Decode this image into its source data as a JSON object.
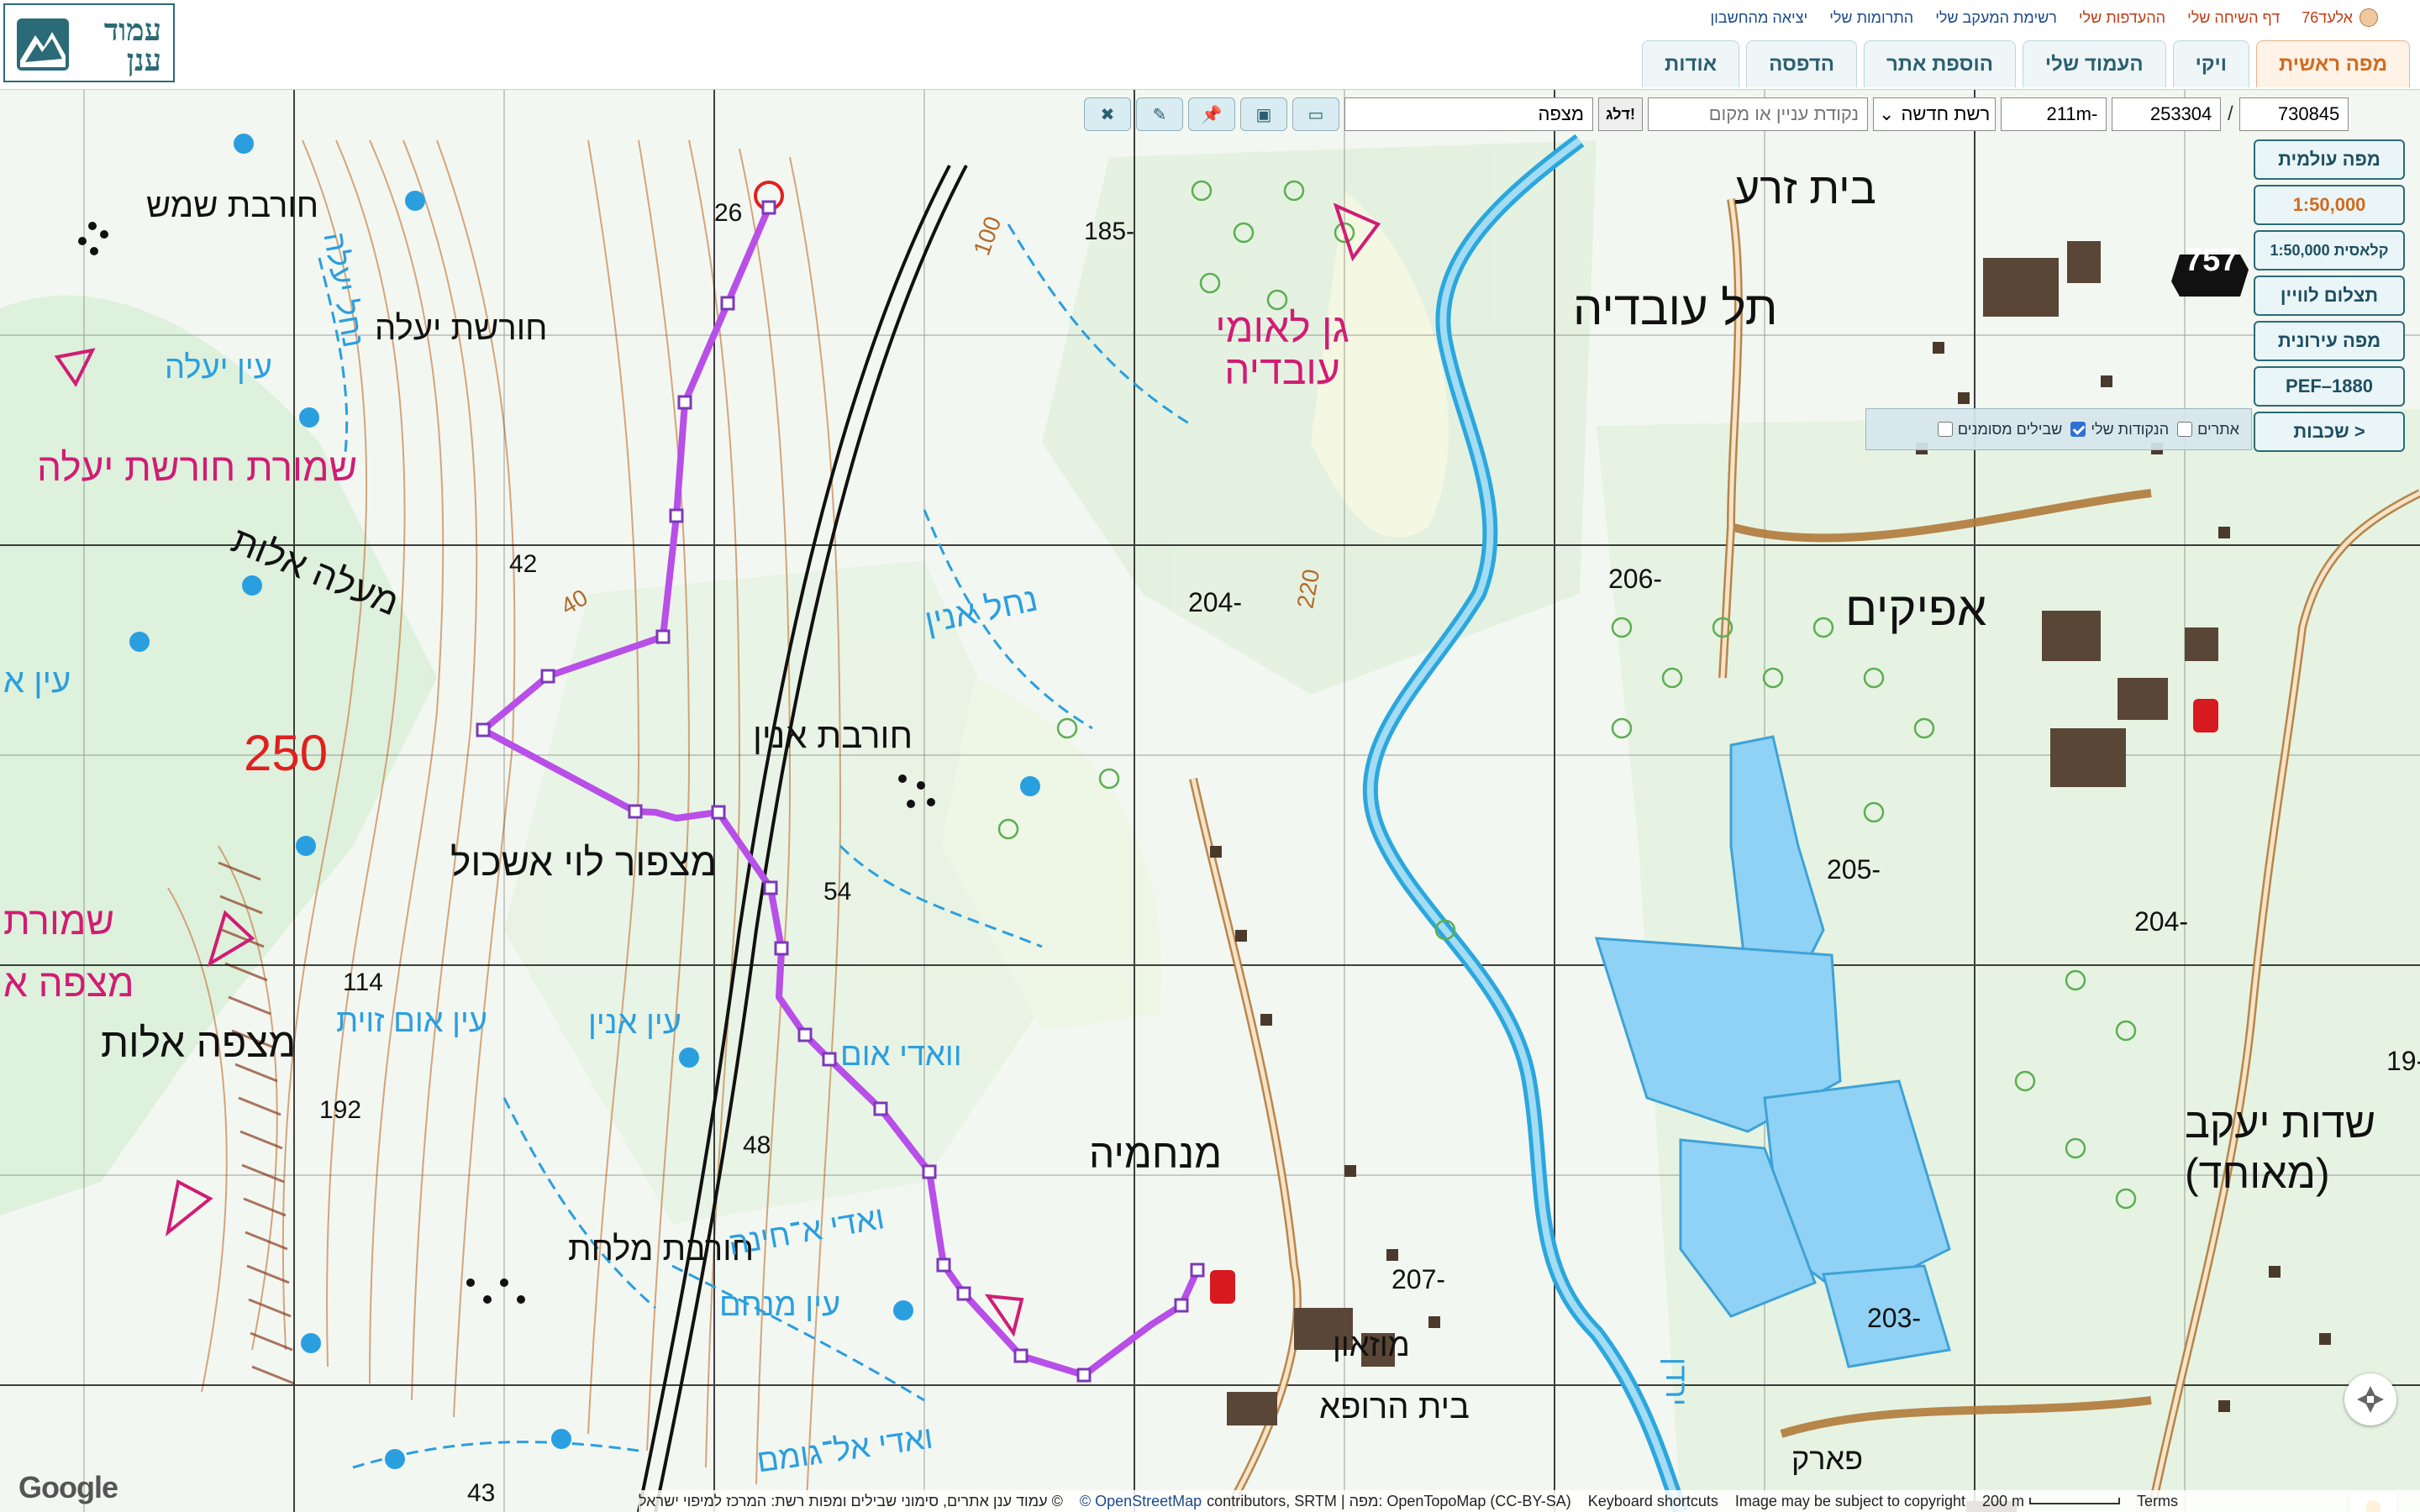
{
  "logo": {
    "line1": "עמוד",
    "line2": "ענן"
  },
  "user_links": {
    "user": "אלעד76",
    "items": [
      "דף השיחה שלי",
      "ההעדפות שלי",
      "רשימת המעקב שלי",
      "התרומות שלי",
      "יציאה מהחשבון"
    ]
  },
  "tabs": [
    "מפה ראשית",
    "ויקי",
    "העמוד שלי",
    "הוספת אתר",
    "הדפסה",
    "אודות"
  ],
  "toolbar": {
    "coord_x": "730845",
    "coord_sep": "/",
    "coord_y": "253304",
    "elevation": "211m-",
    "grid_select": "רשת חדשה",
    "search_placeholder": "נקודת עניין או מקום",
    "jump_button": "דלג!",
    "place_value": "מצפה",
    "icons": [
      "folder-open-icon",
      "save-icon",
      "pin-icon",
      "pencil-icon",
      "close-icon"
    ]
  },
  "layers": {
    "buttons": [
      "מפה עולמית",
      "1:50,000",
      "1:50,000 קלאסית",
      "תצלום לוויין",
      "מפה עירונית",
      "PEF–1880",
      "שכבות >"
    ],
    "active": "1:50,000",
    "overlays": [
      {
        "label": "אתרים",
        "checked": false
      },
      {
        "label": "הנקודות שלי",
        "checked": true
      },
      {
        "label": "שבילים מסומנים",
        "checked": false
      }
    ]
  },
  "map": {
    "places": [
      "חורבת שמש",
      "חורשת יעלה",
      "עין יעלה",
      "שמורת חורשת יעלה",
      "מעלה אלות",
      "עין א",
      "חורבת אנין",
      "מצפור לוי אשכול",
      "מצפה אלות",
      "שמורת",
      "מצפה א",
      "עין אום זוית",
      "עין אנין",
      "וואדי אום",
      "חורבת מלחת",
      "ואדי א־חינה",
      "עין מנחם",
      "ואדי אל־גומם",
      "מנחמיה",
      "מוזאון",
      "בית הרופא",
      "גן לאומי עובדיה",
      "תל עובדיה",
      "בית זרע",
      "אפיקים",
      "נחל אנין",
      "נחל יעלה",
      "ירדן",
      "שדות יעקב (מאוחד)",
      "פארק"
    ],
    "elevations": [
      "26",
      "42",
      "40",
      "54",
      "114",
      "192",
      "48",
      "43",
      "185-",
      "204-",
      "206-",
      "205-",
      "204-",
      "203-",
      "207-",
      "19-",
      "100",
      "220"
    ],
    "spot_250": "250",
    "road_757": "757"
  },
  "attribution": {
    "google": "Google",
    "left": "© עמוד ענן אתרים, סימוני שבילים ומפות רשת: המרכז למיפוי ישראל",
    "osm": "© OpenStreetMap",
    "osm_rest": "contributors, SRTM | מפה: OpenTopoMap (CC-BY-SA)",
    "keyboard": "Keyboard shortcuts",
    "copyright": "Image may be subject to copyright",
    "scale": "200 m",
    "terms": "Terms"
  },
  "colors": {
    "brand": "#2b6b78",
    "active_tab": "#d06b1f",
    "trail": "#b84fe8",
    "river": "#1f9ad8",
    "hebrew_place": "#d11c74"
  }
}
